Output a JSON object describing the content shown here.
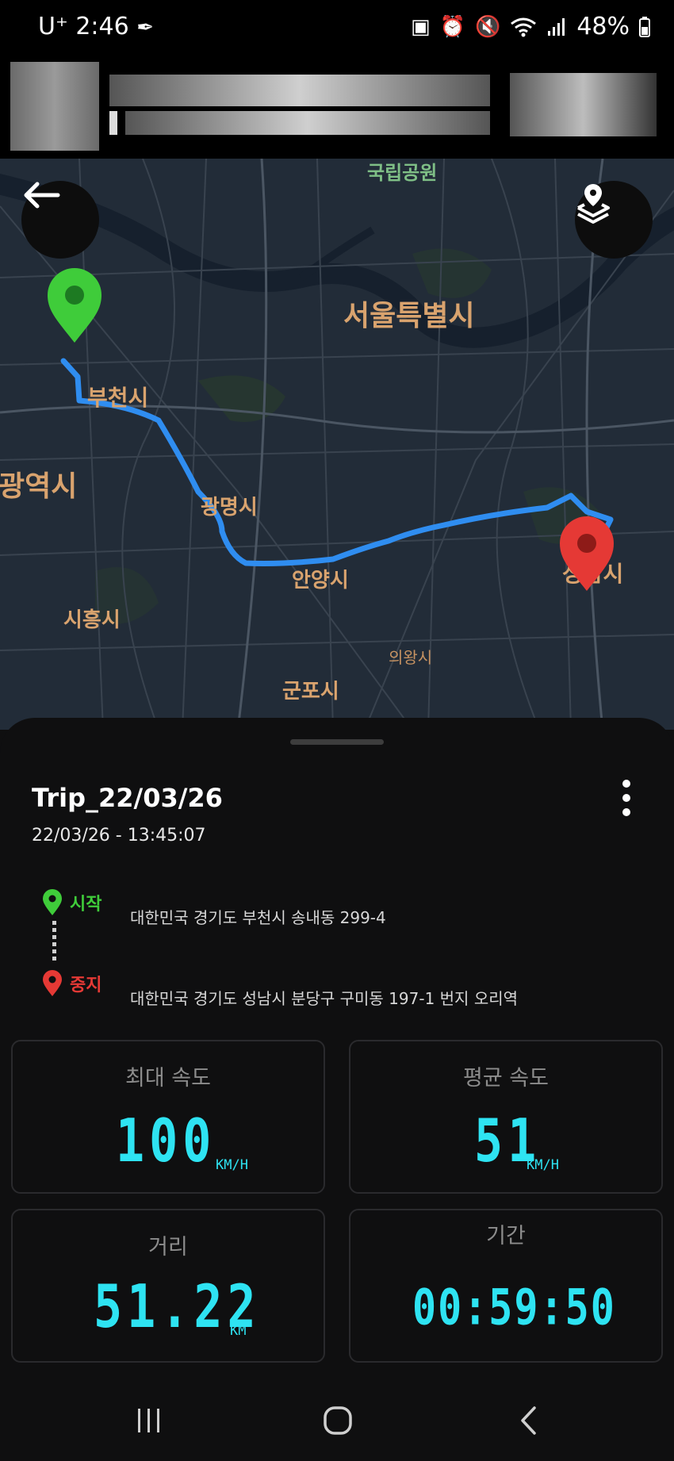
{
  "status_bar": {
    "carrier": "U⁺",
    "time": "2:46",
    "battery": "48%",
    "icons": [
      "feather-icon",
      "battery-saver-icon",
      "alarm-icon",
      "mute-icon",
      "wifi-icon",
      "signal-icon",
      "battery-icon"
    ]
  },
  "map": {
    "labels": {
      "park": "국립공원",
      "seoul": "서울특별시",
      "bucheon": "부천시",
      "incheon": "광역시",
      "gwangmyeong": "광명시",
      "anyang": "안양시",
      "siheung": "시흥시",
      "seongnam": "성남시",
      "uiwang": "의왕시",
      "gunpo": "군포시"
    },
    "route_color": "#2f8df0",
    "start_pin_color": "#3fcc3a",
    "end_pin_color": "#e53935"
  },
  "trip": {
    "title": "Trip_22/03/26",
    "date": "22/03/26 - 13:45:07",
    "start_label": "시작",
    "start_address": "대한민국 경기도 부천시 송내동 299-4",
    "stop_label": "중지",
    "stop_address": "대한민국 경기도 성남시 분당구 구미동 197-1 번지 오리역"
  },
  "stats": {
    "max_speed": {
      "label": "최대 속도",
      "value": "100",
      "unit": "KM/H"
    },
    "avg_speed": {
      "label": "평균 속도",
      "value": "51",
      "unit": "KM/H"
    },
    "distance": {
      "label": "거리",
      "value": "51.22",
      "unit": "KM"
    },
    "duration": {
      "label": "기간",
      "value": "00:59:50"
    }
  },
  "colors": {
    "accent_cyan": "#2ee3f2",
    "start_green": "#3fcc3a",
    "stop_red": "#e53935"
  }
}
